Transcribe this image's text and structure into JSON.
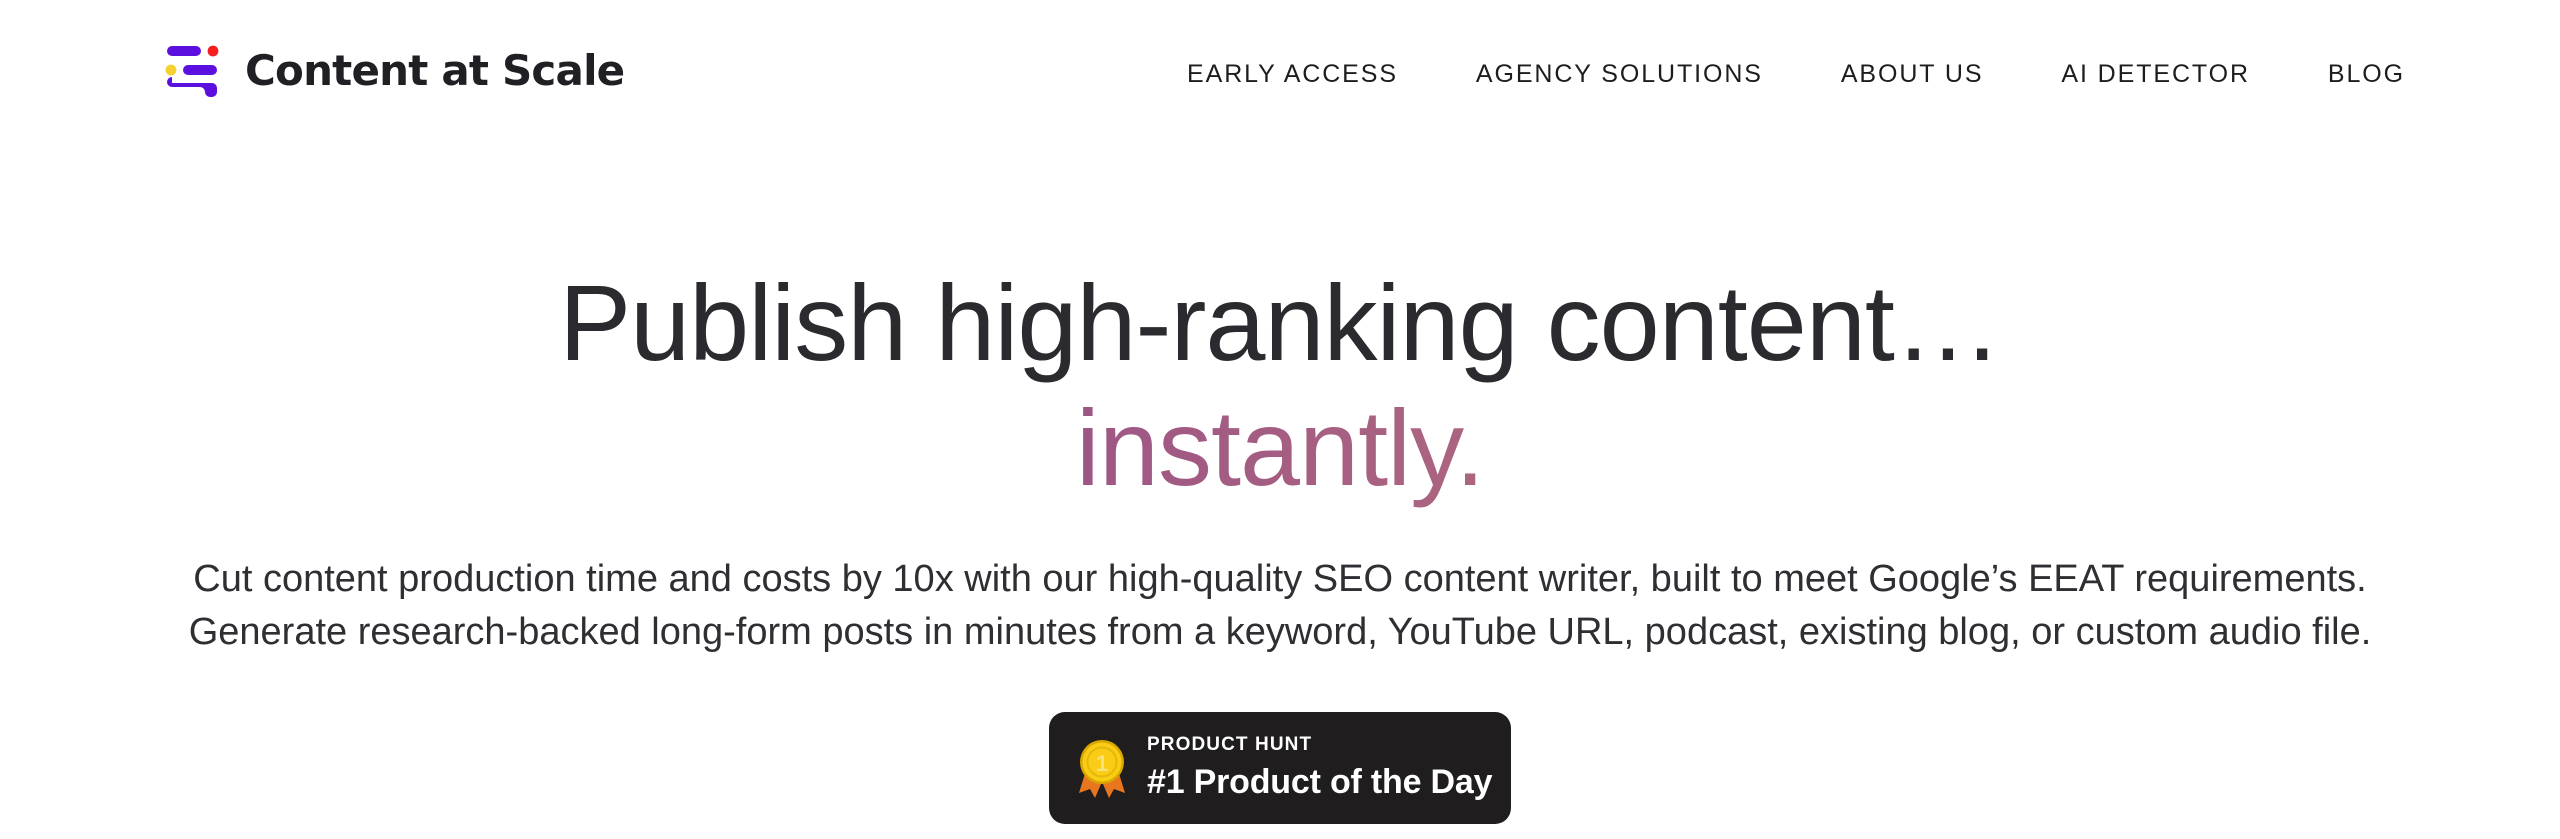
{
  "brand": {
    "name": "Content at Scale",
    "logo_icon": "content-at-scale-logo-icon",
    "colors": {
      "bar_purple": "#5B10E0",
      "dot_red": "#F51E1E",
      "dot_yellow": "#F5D030",
      "wordmark": "#201F24"
    }
  },
  "nav": {
    "items": [
      {
        "label": "EARLY ACCESS"
      },
      {
        "label": "AGENCY SOLUTIONS"
      },
      {
        "label": "ABOUT US"
      },
      {
        "label": "AI DETECTOR"
      },
      {
        "label": "BLOG"
      }
    ]
  },
  "hero": {
    "title_line1": "Publish high-ranking content…",
    "title_line2": "instantly.",
    "title_color": "#2B2B2F",
    "accent_gradient_from": "#7B3F98",
    "accent_gradient_to": "#C98C7D",
    "subtitle_line1": "Cut content production time and costs by 10x with our high-quality SEO content writer, built to meet Google’s EEAT requirements.",
    "subtitle_line2": "Generate research-backed long-form posts in minutes from a keyword, YouTube URL, podcast, existing blog, or custom audio file."
  },
  "product_hunt_badge": {
    "kicker": "PRODUCT HUNT",
    "title": "#1 Product of the Day",
    "medal_icon": "gold-medal-icon",
    "medal_number": "1",
    "background_color": "#1F1D1E",
    "text_color": "#FFFFFF"
  }
}
